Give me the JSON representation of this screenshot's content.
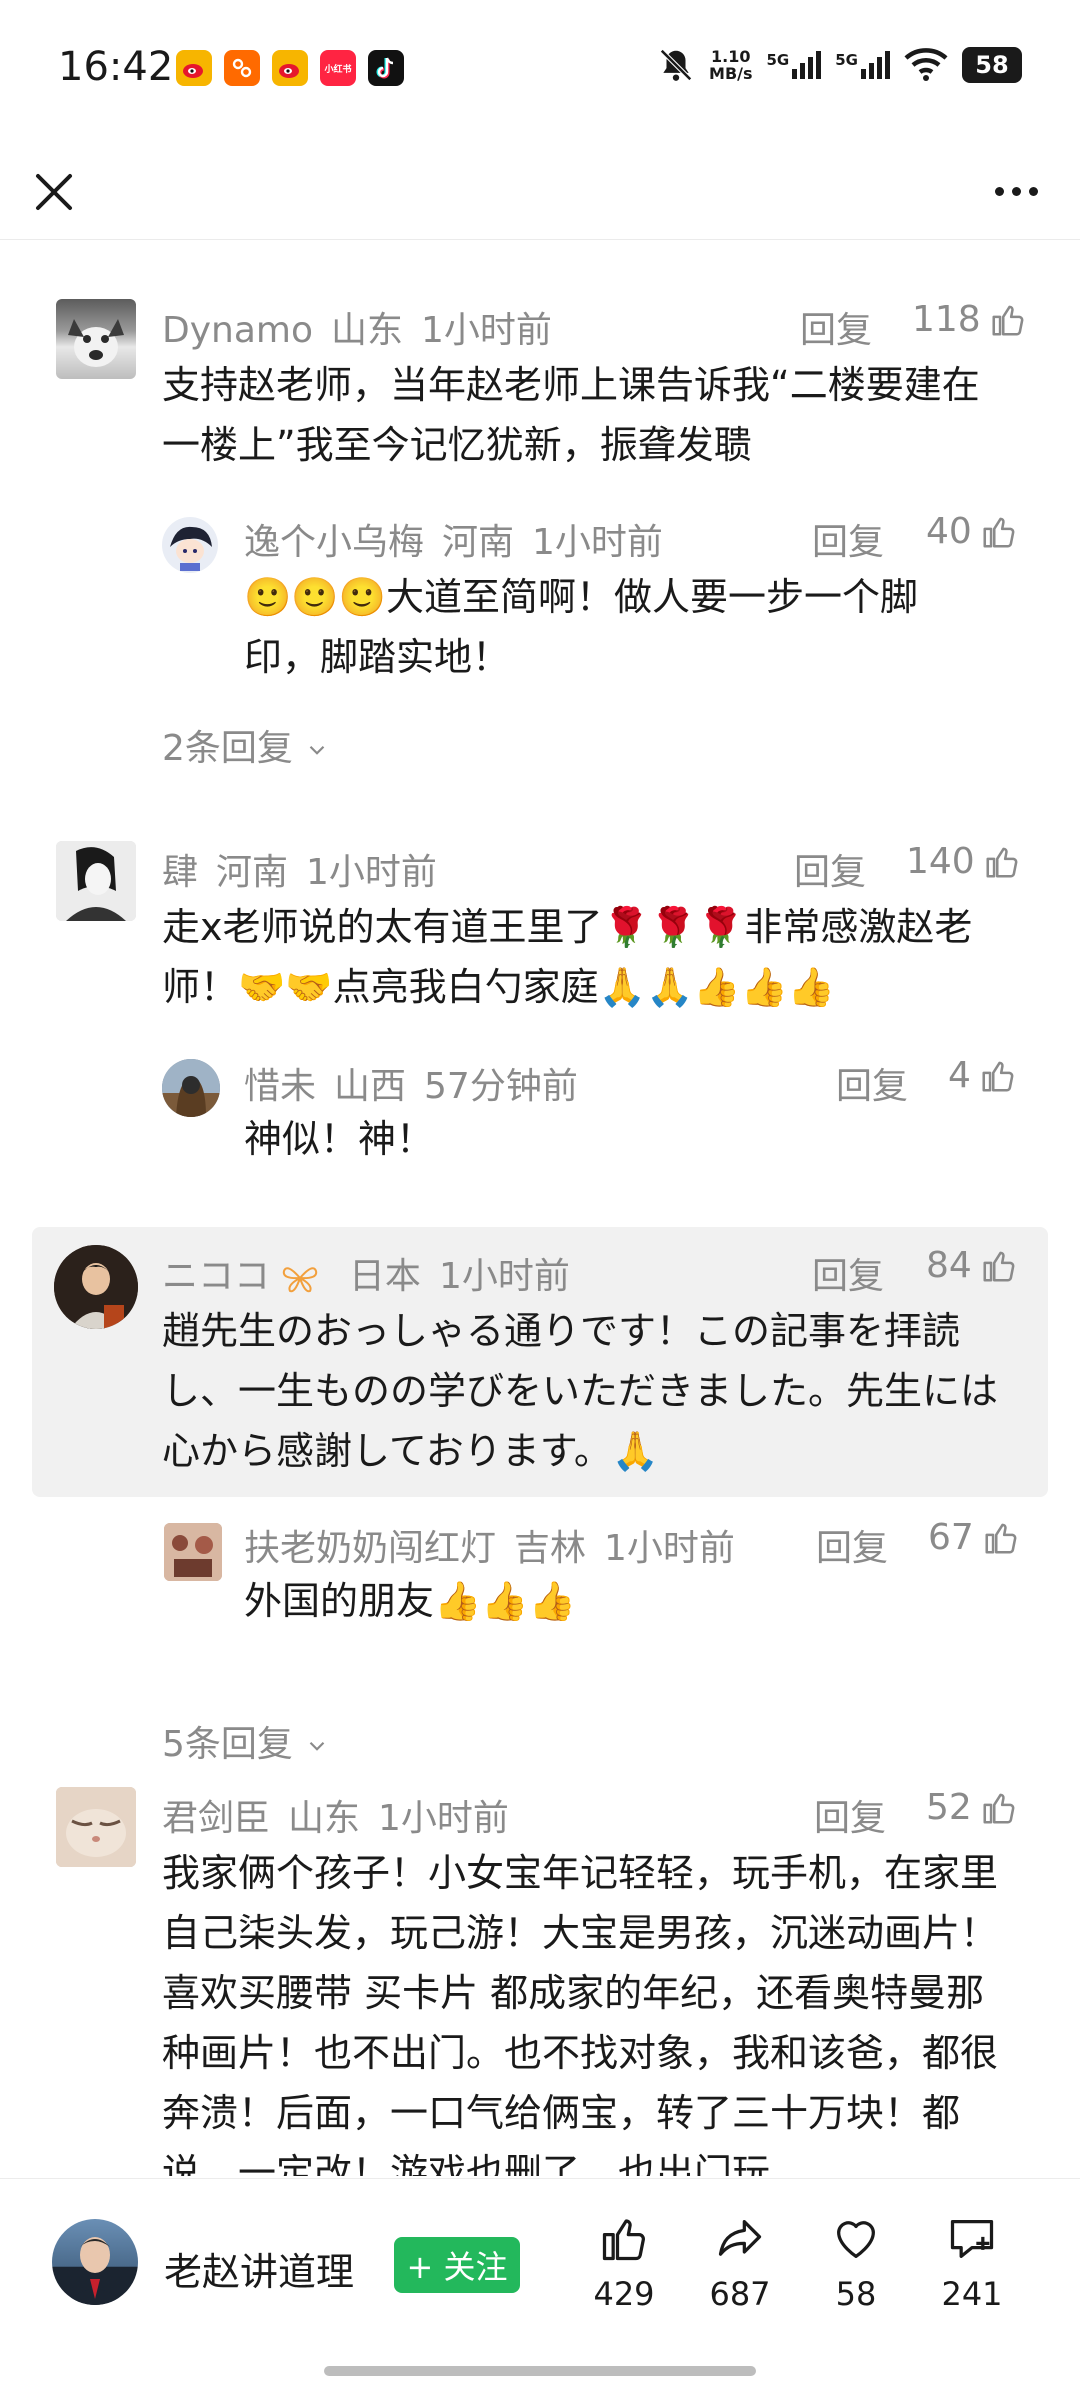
{
  "status_bar": {
    "time": "16:42",
    "apps": [
      {
        "icon": "weibo-icon",
        "label": "",
        "color": "#f7b500"
      },
      {
        "icon": "taobao-icon",
        "label": "",
        "color": "#ff6a00"
      },
      {
        "icon": "weibo-icon",
        "label": "",
        "color": "#f7b500"
      },
      {
        "icon": "xiaohongshu-icon",
        "label": "小红书",
        "color": "#ff2442"
      },
      {
        "icon": "douyin-icon",
        "label": "",
        "color": "#111111"
      }
    ],
    "net_speed_value": "1.10",
    "net_speed_unit": "MB/s",
    "signal_1": "5G",
    "signal_2": "5G",
    "battery": "58"
  },
  "comments": [
    {
      "user": "Dynamo",
      "location": "山东",
      "time": "1小时前",
      "reply_label": "回复",
      "likes": "118",
      "text": "支持赵老师，当年赵老师上课告诉我“二楼要建在一楼上”我至今记忆犹新，振聋发聩",
      "sub_reply": {
        "user": "逸个小乌梅",
        "location": "河南",
        "time": "1小时前",
        "reply_label": "回复",
        "likes": "40",
        "text": "🙂🙂🙂大道至简啊！做人要一步一个脚印，脚踏实地！"
      },
      "more_replies": "2条回复"
    },
    {
      "user": "肆",
      "location": "河南",
      "time": "1小时前",
      "reply_label": "回复",
      "likes": "140",
      "text": "走x老师说的太有道王里了🌹🌹🌹非常感激赵老师！🤝🤝点亮我白勺家庭🙏🙏👍👍👍",
      "sub_reply": {
        "user": "惜未",
        "location": "山西",
        "time": "57分钟前",
        "reply_label": "回复",
        "likes": "4",
        "text": "神似！神！"
      }
    },
    {
      "user": "ニココ",
      "location": "日本",
      "time": "1小时前",
      "reply_label": "回复",
      "likes": "84",
      "text": "趙先生のおっしゃる通りです！この記事を拝読し、一生ものの学びをいただきました。先生には心から感謝しております。🙏",
      "sub_reply": {
        "user": "扶老奶奶闯红灯",
        "location": "吉林",
        "time": "1小时前",
        "reply_label": "回复",
        "likes": "67",
        "text": "外国的朋友👍👍👍"
      },
      "more_replies": "5条回复"
    },
    {
      "user": "君剑臣",
      "location": "山东",
      "time": "1小时前",
      "reply_label": "回复",
      "likes": "52",
      "text": "我家俩个孩子！小女宝年记轻轻，玩手机，在家里自己柒头发，玩己游！大宝是男孩，沉迷动画片！喜欢买腰带 买卡片 都成家的年纪，还看奥特曼那种画片！也不出门。也不找对象，我和该爸，都很奔溃！后面，一口气给俩宝，转了三十万块！都说，一定改！游戏也删了，也出门玩"
    }
  ],
  "bottom_bar": {
    "author_name": "老赵讲道理",
    "follow_label": "+ 关注",
    "likes": "429",
    "shares": "687",
    "favorites": "58",
    "comments": "241"
  },
  "colors": {
    "accent_green": "#23b85c",
    "meta_gray": "#8a8a8a",
    "highlight_bg": "#f1f1f1"
  }
}
